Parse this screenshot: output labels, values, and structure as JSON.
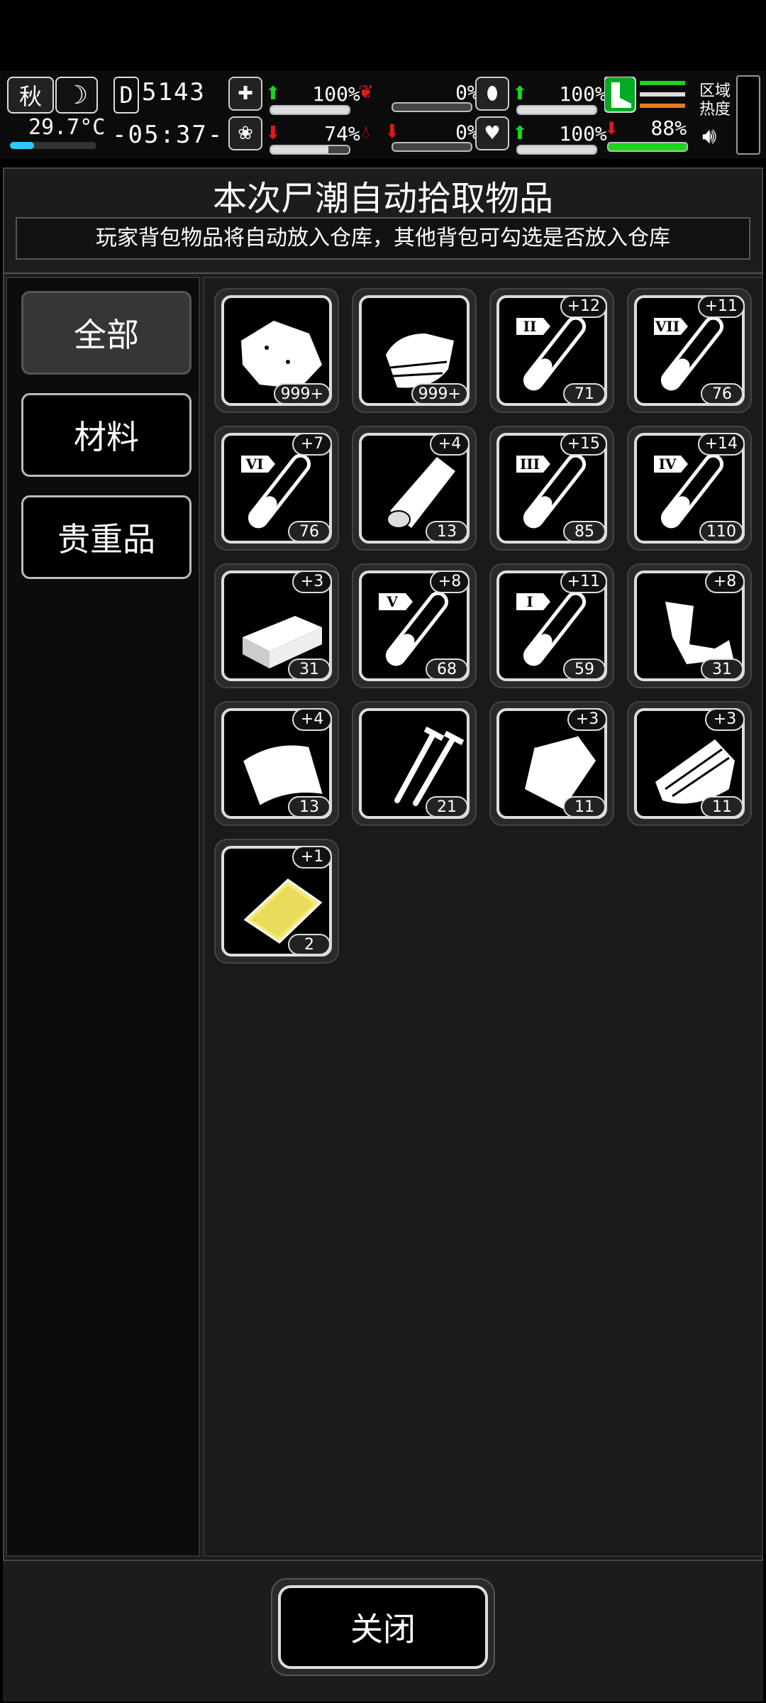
{
  "hud": {
    "season": "秋",
    "temperature": "29.7°C",
    "day_letter": "D",
    "day_number": "5143",
    "time": "-05:37-",
    "stats": [
      {
        "name": "health",
        "trend": "up",
        "value": "100%"
      },
      {
        "name": "hunger",
        "trend": "none",
        "value": "0%"
      },
      {
        "name": "stamina",
        "trend": "up",
        "value": "100%"
      },
      {
        "name": "mental",
        "trend": "down",
        "value": "74%"
      },
      {
        "name": "bleeding",
        "trend": "down",
        "value": "0%"
      },
      {
        "name": "mood",
        "trend": "up",
        "value": "100%"
      },
      {
        "name": "endurance",
        "trend": "down",
        "value": "88%"
      }
    ],
    "region_heat_label": "区域\n热度",
    "colors": {
      "up": "#1bd61b",
      "down": "#e01a1a",
      "accent": "#2fc8ff"
    }
  },
  "header": {
    "title": "本次尸潮自动拾取物品",
    "subtitle": "玩家背包物品将自动放入仓库，其他背包可勾选是否放入仓库"
  },
  "tabs": [
    {
      "label": "全部",
      "active": true
    },
    {
      "label": "材料",
      "active": false
    },
    {
      "label": "贵重品",
      "active": false
    }
  ],
  "items": [
    {
      "icon": "cloth-scrap-icon",
      "count": "999+",
      "bonus": ""
    },
    {
      "icon": "towel-stack-icon",
      "count": "999+",
      "bonus": ""
    },
    {
      "icon": "test-tube-icon",
      "tier": "II",
      "count": "71",
      "bonus": "+12"
    },
    {
      "icon": "test-tube-icon",
      "tier": "VII",
      "count": "76",
      "bonus": "+11"
    },
    {
      "icon": "test-tube-icon",
      "tier": "VI",
      "count": "76",
      "bonus": "+7"
    },
    {
      "icon": "wood-plank-icon",
      "count": "13",
      "bonus": "+4"
    },
    {
      "icon": "test-tube-icon",
      "tier": "III",
      "count": "85",
      "bonus": "+15"
    },
    {
      "icon": "test-tube-icon",
      "tier": "IV",
      "count": "110",
      "bonus": "+14"
    },
    {
      "icon": "metal-block-icon",
      "count": "31",
      "bonus": "+3"
    },
    {
      "icon": "test-tube-icon",
      "tier": "V",
      "count": "68",
      "bonus": "+8"
    },
    {
      "icon": "test-tube-icon",
      "tier": "I",
      "count": "59",
      "bonus": "+11"
    },
    {
      "icon": "scrap-metal-icon",
      "count": "31",
      "bonus": "+8"
    },
    {
      "icon": "leather-sheet-icon",
      "count": "13",
      "bonus": "+4"
    },
    {
      "icon": "screws-icon",
      "count": "21",
      "bonus": ""
    },
    {
      "icon": "pouch-icon",
      "count": "11",
      "bonus": "+3"
    },
    {
      "icon": "bark-bundle-icon",
      "count": "11",
      "bonus": "+3"
    },
    {
      "icon": "gold-bar-icon",
      "count": "2",
      "bonus": "+1"
    }
  ],
  "footer": {
    "close_label": "关闭"
  }
}
